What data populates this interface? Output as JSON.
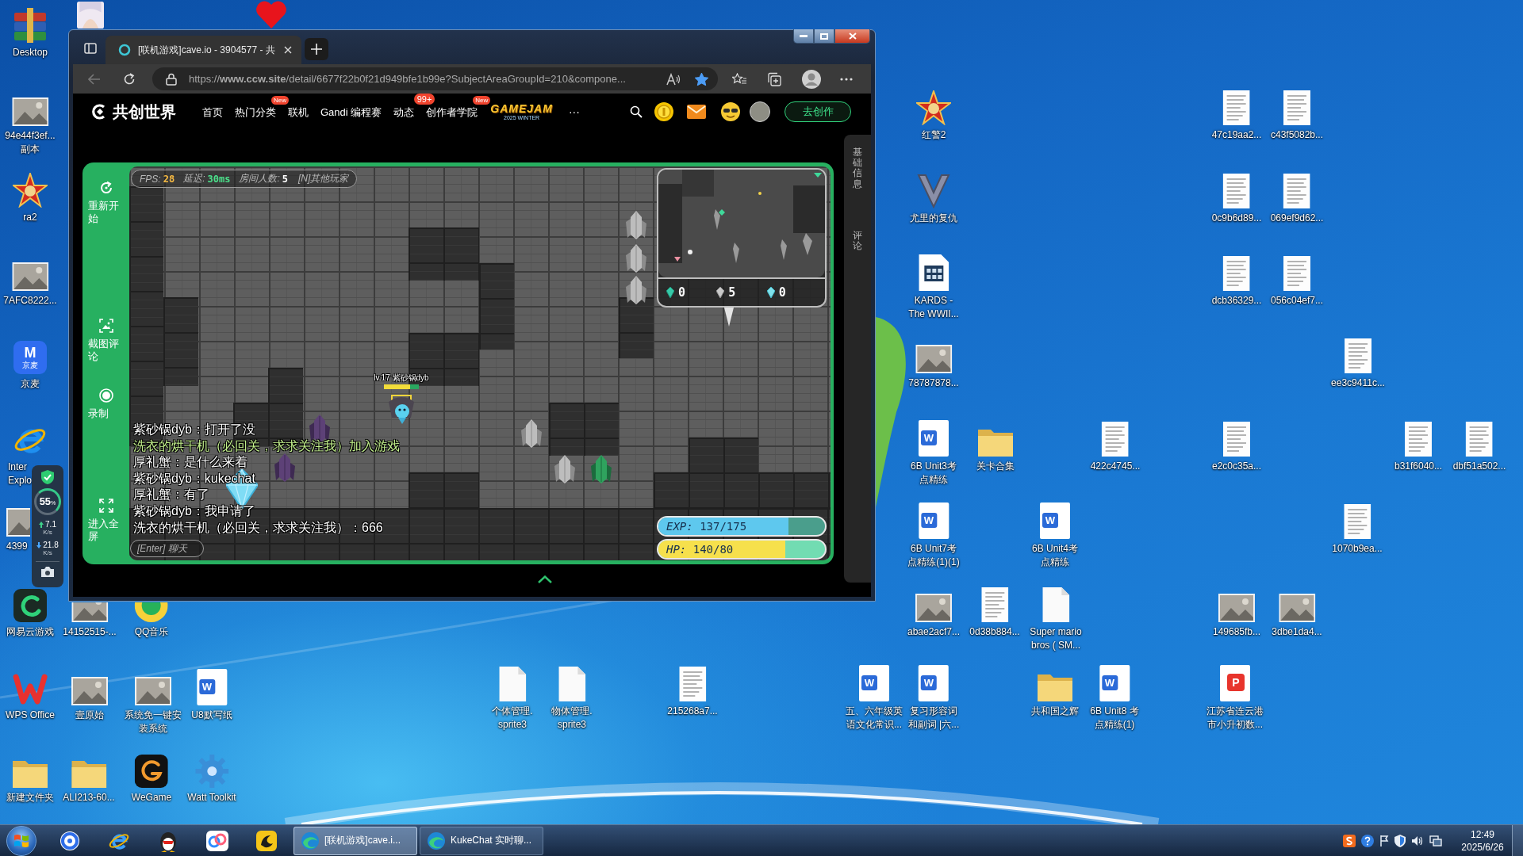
{
  "desktop_icons": [
    {
      "kind": "archive",
      "label": [
        "Desktop"
      ]
    },
    {
      "kind": "picture"
    },
    {
      "kind": "heart"
    },
    {
      "kind": "photo",
      "label": [
        "94e44f3ef...",
        "副本"
      ]
    },
    {
      "kind": "red-star",
      "label": [
        "ra2"
      ]
    },
    {
      "kind": "photo",
      "label": [
        "7AFC8222..."
      ]
    },
    {
      "kind": "tile",
      "glyph": "M",
      "caption": "京麦",
      "label": [
        "京麦"
      ]
    },
    {
      "kind": "ie",
      "label": [
        "Inter",
        "Explo"
      ]
    },
    {
      "kind": "photo",
      "label": [
        "4399"
      ]
    },
    {
      "kind": "cloud-game",
      "label": [
        "网易云游戏"
      ]
    },
    {
      "kind": "photo",
      "label": [
        "14152515-..."
      ]
    },
    {
      "kind": "music",
      "label": [
        "QQ音乐"
      ]
    },
    {
      "kind": "wps",
      "label": [
        "WPS Office"
      ]
    },
    {
      "kind": "photo",
      "label": [
        "壹原始"
      ]
    },
    {
      "kind": "photo",
      "label": [
        "系统免一键安",
        "装系统"
      ]
    },
    {
      "kind": "word",
      "glyph": "W",
      "label": [
        "U8默写纸"
      ]
    },
    {
      "kind": "folder",
      "label": [
        "新建文件夹"
      ]
    },
    {
      "kind": "folder",
      "label": [
        "ALI213-60..."
      ]
    },
    {
      "kind": "wegame",
      "label": [
        "WeGame"
      ]
    },
    {
      "kind": "gear",
      "label": [
        "Watt Toolkit"
      ]
    },
    {
      "kind": "red-star",
      "label": [
        "红警2"
      ]
    },
    {
      "kind": "emblem",
      "label": [
        "尤里的复仇"
      ]
    },
    {
      "kind": "app-file",
      "label": [
        "KARDS -",
        "The WWII..."
      ]
    },
    {
      "kind": "photo",
      "label": [
        "78787878..."
      ]
    },
    {
      "kind": "word",
      "glyph": "W",
      "label": [
        "6B Unit3考",
        "点精练"
      ]
    },
    {
      "kind": "folder",
      "label": [
        "关卡合集"
      ]
    },
    {
      "kind": "doc",
      "label": [
        "422c4745..."
      ]
    },
    {
      "kind": "doc",
      "label": [
        "e2c0c35a..."
      ]
    },
    {
      "kind": "doc",
      "label": [
        "b31f6040..."
      ]
    },
    {
      "kind": "doc",
      "label": [
        "dbf51a502..."
      ]
    },
    {
      "kind": "word",
      "glyph": "W",
      "label": [
        "6B Unit7考",
        "点精练(1)(1)"
      ]
    },
    {
      "kind": "word",
      "glyph": "W",
      "label": [
        "6B Unit4考",
        "点精练"
      ]
    },
    {
      "kind": "doc",
      "label": [
        "1070b9ea..."
      ]
    },
    {
      "kind": "photo",
      "label": [
        "abae2acf7..."
      ]
    },
    {
      "kind": "doc",
      "label": [
        "0d38b884..."
      ]
    },
    {
      "kind": "file",
      "label": [
        "Super mario",
        "bros ( SM..."
      ]
    },
    {
      "kind": "photo",
      "label": [
        "149685fb..."
      ]
    },
    {
      "kind": "photo",
      "label": [
        "3dbe1da4..."
      ]
    },
    {
      "kind": "doc",
      "label": [
        "47c19aa2..."
      ]
    },
    {
      "kind": "doc",
      "label": [
        "c43f5082b..."
      ]
    },
    {
      "kind": "doc",
      "label": [
        "0c9b6d89..."
      ]
    },
    {
      "kind": "doc",
      "label": [
        "069ef9d62..."
      ]
    },
    {
      "kind": "doc",
      "label": [
        "dcb36329..."
      ]
    },
    {
      "kind": "doc",
      "label": [
        "056c04ef7..."
      ]
    },
    {
      "kind": "doc",
      "label": [
        "ee3c9411c..."
      ]
    },
    {
      "kind": "file",
      "label": [
        "个体管理.",
        "sprite3"
      ]
    },
    {
      "kind": "file",
      "label": [
        "物体管理.",
        "sprite3"
      ]
    },
    {
      "kind": "doc",
      "label": [
        "215268a7..."
      ]
    },
    {
      "kind": "word",
      "glyph": "W",
      "label": [
        "五、六年级英",
        "语文化常识..."
      ]
    },
    {
      "kind": "word",
      "glyph": "W",
      "label": [
        "复习形容词",
        "和副词 |六..."
      ]
    },
    {
      "kind": "folder",
      "label": [
        "共和国之辉"
      ]
    },
    {
      "kind": "word",
      "glyph": "W",
      "label": [
        "6B Unit8 考",
        "点精练(1)"
      ]
    },
    {
      "kind": "pdf",
      "glyph": "P",
      "label": [
        "江苏省连云港",
        "市小升初数..."
      ]
    }
  ],
  "system_widget": {
    "percent": "55",
    "percent_unit": "%",
    "upload": "7.1",
    "upload_unit": "K/s",
    "download": "21.8",
    "download_unit": "K/s"
  },
  "browser": {
    "tabs": [
      {
        "title": "[联机游戏]cave.io - 3904577 - 共",
        "selected": true
      }
    ],
    "address": "https://**www.ccw.site**/detail/6677f22b0f21d949bfe1b99e?SubjectAreaGroupId=210&compone...",
    "favorite": true,
    "site": {
      "logo": "共创世界",
      "nav": [
        {
          "label": "首页"
        },
        {
          "label": "热门分类",
          "badge": "New"
        },
        {
          "label": "联机"
        },
        {
          "label": "Gandi 编程赛"
        },
        {
          "label": "动态",
          "badge": "99+"
        },
        {
          "label": "创作者学院",
          "badge": "New"
        }
      ],
      "event_logo": {
        "title": "GAMEJAM",
        "subtitle": "2025 WINTER"
      },
      "more": "···",
      "create_button": "去创作"
    },
    "side_tabs": [
      "基础信息",
      "评论"
    ]
  },
  "game": {
    "tools": [
      {
        "kind": "restart",
        "label": "重新开始"
      },
      {
        "kind": "screenshot",
        "label": "截图评论"
      },
      {
        "kind": "record",
        "label": "录制"
      },
      {
        "kind": "fullscreen",
        "label": "进入全屏"
      }
    ],
    "hud": [
      {
        "kind": "fps",
        "label": "FPS:",
        "value": "28"
      },
      {
        "kind": "latency",
        "label": "延迟:",
        "value": "30ms"
      },
      {
        "kind": "players",
        "label": "房间人数:",
        "value": "5"
      }
    ],
    "hud_hint": "[N]其他玩家",
    "player": {
      "name": "lv.17 紫砂锅dyb",
      "level": 0.75
    },
    "gem_counters": [
      {
        "kind": "emerald",
        "count": "0"
      },
      {
        "kind": "stone",
        "count": "5"
      },
      {
        "kind": "ice",
        "count": "0"
      }
    ],
    "chat": [
      {
        "kind": "chat",
        "text": "紫砂锅dyb：打开了没"
      },
      {
        "kind": "system",
        "text": "洗衣的烘干机（必回关，求求关注我）加入游戏"
      },
      {
        "kind": "chat",
        "text": "厚礼蟹：是什么来着"
      },
      {
        "kind": "chat",
        "text": "紫砂锅dyb：kukechat"
      },
      {
        "kind": "chat",
        "text": "厚礼蟹：有了"
      },
      {
        "kind": "chat",
        "text": "紫砂锅dyb：我申请了"
      },
      {
        "kind": "chat",
        "text": "洗衣的烘干机（必回关，求求关注我）：666"
      }
    ],
    "chat_placeholder": "[Enter] 聊天",
    "stat_bars": [
      {
        "kind": "exp",
        "text": "*EXP:* 137/175",
        "level": 0.78
      },
      {
        "kind": "hp",
        "text": "*HP:* 140/80",
        "level": 0.76
      }
    ]
  },
  "taskbar": {
    "tasks": [
      {
        "title": "[联机游戏]cave.i...",
        "selected": true
      },
      {
        "title": "KukeChat 实时聊...",
        "selected": false
      }
    ],
    "clock": {
      "time": "12:49",
      "date": "2025/6/26"
    }
  }
}
